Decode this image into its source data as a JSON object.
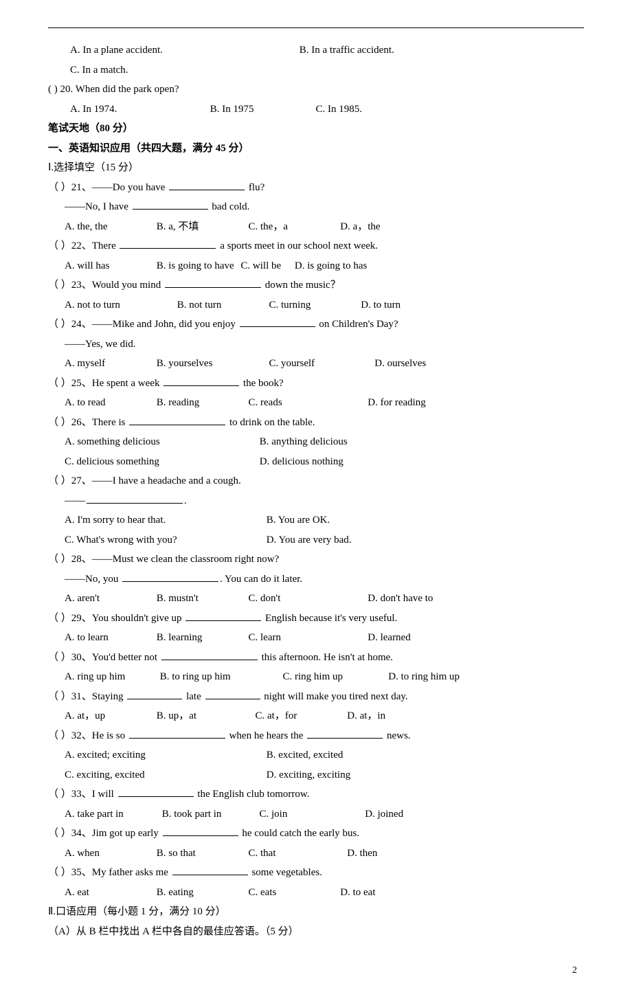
{
  "q19": {
    "optA": "A. In a plane accident.",
    "optB": "B. In a traffic accident.",
    "optC": "C. In a match."
  },
  "q20": {
    "stem": "(    ) 20. When did the park open?",
    "optA": "A. In 1974.",
    "optB": "B. In 1975",
    "optC": "C. In 1985."
  },
  "sectionWritten": "笔试天地（80 分）",
  "sectionOne": "一、英语知识应用（共四大题，满分 45 分）",
  "partI": "Ⅰ.选择填空（15 分）",
  "q21": {
    "stemPre": "（    ）21、——Do you have ",
    "stemPost": " flu?",
    "line2Pre": "——No, I have ",
    "line2Post": " bad cold.",
    "optA": "A. the, the",
    "optB": "B. a, 不填",
    "optC": "C. the，a",
    "optD": "D. a，the"
  },
  "q22": {
    "stemPre": "（    ）22、There ",
    "stemPost": " a sports meet in our school next week.",
    "optA": "A. will has",
    "optB": "B. is going to have",
    "optC": "C. will be",
    "optD": "D. is going to has"
  },
  "q23": {
    "stemPre": "（    ）23、Would you mind ",
    "stemPost": " down the music？",
    "optA": "A. not to turn",
    "optB": "B. not turn",
    "optC": "C. turning",
    "optD": "D. to turn"
  },
  "q24": {
    "stemPre": "（    ）24、——Mike and John, did you enjoy ",
    "stemPost": " on Children's Day?",
    "line2": "——Yes, we did.",
    "optA": "A. myself",
    "optB": "B. yourselves",
    "optC": "C. yourself",
    "optD": "D. ourselves"
  },
  "q25": {
    "stemPre": "（    ）25、He spent a week ",
    "stemPost": " the book?",
    "optA": "A. to read",
    "optB": "B. reading",
    "optC": "C. reads",
    "optD": "D. for reading"
  },
  "q26": {
    "stemPre": "（    ）26、There is ",
    "stemPost": " to drink on the table.",
    "optA": "A. something delicious",
    "optB": "B. anything delicious",
    "optC": "C. delicious something",
    "optD": "D. delicious nothing"
  },
  "q27": {
    "stem": "（    ）27、——I have a headache and a cough.",
    "line2Pre": "——",
    "line2Post": ".",
    "optA": "A. I'm sorry to hear that.",
    "optB": "B. You are OK.",
    "optC": "C. What's wrong with you?",
    "optD": "D. You are very bad."
  },
  "q28": {
    "stem": "（    ）28、——Must  we clean the classroom right now?",
    "line2Pre": "——No, you ",
    "line2Post": ". You can do it later.",
    "optA": "A. aren't",
    "optB": "B. mustn't",
    "optC": "C. don't",
    "optD": "D. don't have to"
  },
  "q29": {
    "stemPre": "（    ）29、You shouldn't give up ",
    "stemPost": " English because it's very useful.",
    "optA": "A. to learn",
    "optB": "B. learning",
    "optC": "C. learn",
    "optD": "D. learned"
  },
  "q30": {
    "stemPre": "（    ）30、You'd better not ",
    "stemPost": " this afternoon. He isn't at home.",
    "optA": "A. ring up him",
    "optB": "B. to ring up him",
    "optC": "C. ring him up",
    "optD": "D. to ring him up"
  },
  "q31": {
    "stemPre": "（    ）31、Staying ",
    "stemMid": " late ",
    "stemPost": " night will make you tired next day.",
    "optA": "A. at，up",
    "optB": "B. up，at",
    "optC": "C. at，for",
    "optD": "D. at，in"
  },
  "q32": {
    "stemPre": "（    ）32、He is so ",
    "stemMid": " when he hears the ",
    "stemPost": " news.",
    "optA": "A. excited; exciting",
    "optB": "B. excited, excited",
    "optC": "C. exciting, excited",
    "optD": "D. exciting, exciting"
  },
  "q33": {
    "stemPre": "（    ）33、I will ",
    "stemPost": " the English club tomorrow.",
    "optA": "A. take part in",
    "optB": "B. took part in",
    "optC": "C. join",
    "optD": "D. joined"
  },
  "q34": {
    "stemPre": "（    ）34、Jim got up early ",
    "stemPost": " he could catch the early bus.",
    "optA": "A. when",
    "optB": "B. so that",
    "optC": "C. that",
    "optD": "D. then"
  },
  "q35": {
    "stemPre": "（    ）35、My father asks me ",
    "stemPost": " some vegetables.",
    "optA": "A. eat",
    "optB": "B. eating",
    "optC": "C. eats",
    "optD": "D. to eat"
  },
  "partII": "Ⅱ.口语应用（每小题 1 分，满分 10 分）",
  "partIIa": "（A）从 B 栏中找出 A 栏中各自的最佳应答语。（5 分）",
  "pageNum": "2"
}
